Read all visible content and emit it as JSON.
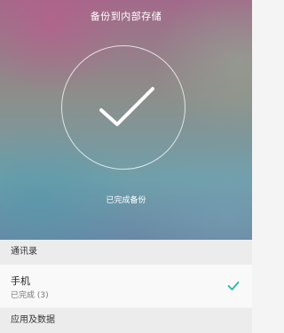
{
  "header": {
    "title": "备份到内部存储"
  },
  "progress": {
    "status_text": "已完成备份",
    "icon": "checkmark-icon"
  },
  "sections": [
    {
      "title": "通讯录",
      "items": [
        {
          "title": "手机",
          "subtitle": "已完成 (3)",
          "icon": "check-icon",
          "accent": "#26b8a0"
        }
      ]
    },
    {
      "title": "应用及数据"
    }
  ]
}
